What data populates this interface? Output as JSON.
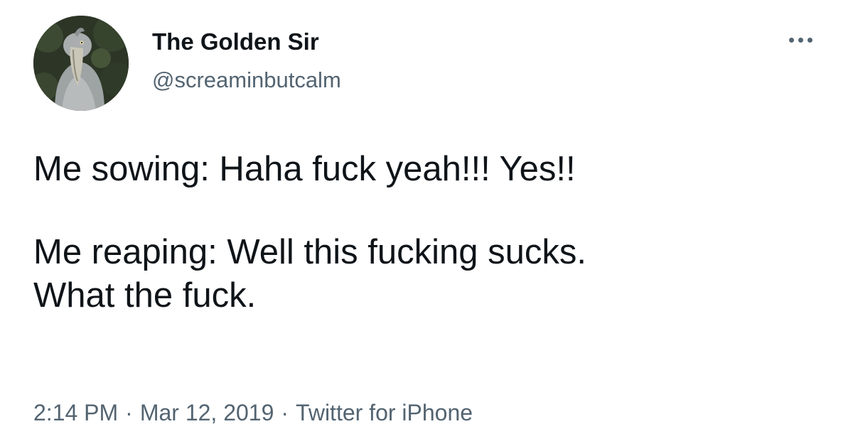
{
  "author": {
    "display_name": "The Golden Sir",
    "handle": "@screaminbutcalm",
    "avatar_icon": "shoebill-bird-avatar"
  },
  "menu": {
    "icon": "more-options-icon"
  },
  "tweet": {
    "line1": "Me sowing: Haha fuck yeah!!! Yes!!",
    "line2": "Me reaping: Well this fucking sucks.",
    "line3": "What the fuck."
  },
  "meta": {
    "time": "2:14 PM",
    "date": "Mar 12, 2019",
    "source": "Twitter for iPhone",
    "separator": "·"
  },
  "colors": {
    "text_primary": "#0f1419",
    "text_secondary": "#536471",
    "background": "#ffffff"
  }
}
